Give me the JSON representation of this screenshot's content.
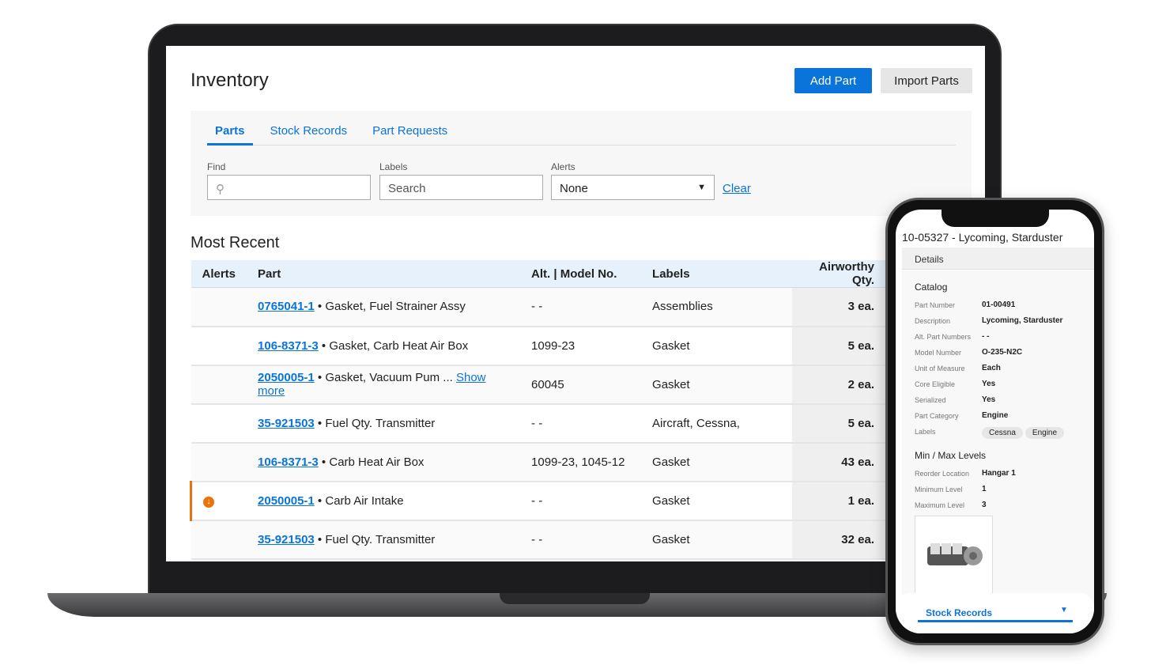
{
  "header": {
    "title": "Inventory",
    "add_part": "Add Part",
    "import_parts": "Import Parts"
  },
  "tabs": [
    {
      "label": "Parts",
      "active": true
    },
    {
      "label": "Stock Records"
    },
    {
      "label": "Part Requests"
    }
  ],
  "filters": {
    "find_label": "Find",
    "find_value": "",
    "labels_label": "Labels",
    "labels_placeholder": "Search",
    "alerts_label": "Alerts",
    "alerts_value": "None",
    "clear": "Clear"
  },
  "section_title": "Most Recent",
  "table": {
    "columns": [
      "Alerts",
      "Part",
      "Alt. | Model No.",
      "Labels",
      "Airworthy Qty."
    ],
    "rows": [
      {
        "alert": false,
        "part_number": "0765041-1",
        "description": "Gasket, Fuel Strainer Assy",
        "show_more": "",
        "model": "- -",
        "labels": "Assemblies",
        "qty": "3 ea."
      },
      {
        "alert": false,
        "part_number": "106-8371-3",
        "description": "Gasket, Carb Heat Air Box",
        "show_more": "",
        "model": "1099-23",
        "labels": "Gasket",
        "qty": "5 ea."
      },
      {
        "alert": false,
        "part_number": "2050005-1",
        "description": "Gasket, Vacuum Pum ...",
        "show_more": "Show more",
        "model": "60045",
        "labels": "Gasket",
        "qty": "2 ea."
      },
      {
        "alert": false,
        "part_number": "35-921503",
        "description": "Fuel Qty. Transmitter",
        "show_more": "",
        "model": "- -",
        "labels": "Aircraft, Cessna,",
        "qty": "5 ea."
      },
      {
        "alert": false,
        "part_number": "106-8371-3",
        "description": "Carb Heat Air Box",
        "show_more": "",
        "model": "1099-23, 1045-12",
        "labels": "Gasket",
        "qty": "43 ea."
      },
      {
        "alert": true,
        "part_number": "2050005-1",
        "description": "Carb Air Intake",
        "show_more": "",
        "model": "- -",
        "labels": "Gasket",
        "qty": "1 ea."
      },
      {
        "alert": false,
        "part_number": "35-921503",
        "description": "Fuel Qty. Transmitter",
        "show_more": "",
        "model": "- -",
        "labels": "Gasket",
        "qty": "32 ea."
      }
    ]
  },
  "phone": {
    "title": "10-05327 - Lycoming, Starduster",
    "details_tab": "Details",
    "catalog_title": "Catalog",
    "catalog": [
      {
        "k": "Part Number",
        "v": "01-00491"
      },
      {
        "k": "Description",
        "v": "Lycoming, Starduster"
      },
      {
        "k": "Alt. Part Numbers",
        "v": "- -"
      },
      {
        "k": "Model Number",
        "v": "O-235-N2C"
      },
      {
        "k": "Unit of Measure",
        "v": "Each"
      },
      {
        "k": "Core Eligible",
        "v": "Yes"
      },
      {
        "k": "Serialized",
        "v": "Yes"
      },
      {
        "k": "Part Category",
        "v": "Engine"
      }
    ],
    "labels_key": "Labels",
    "labels": [
      "Cessna",
      "Engine"
    ],
    "minmax_title": "Min / Max Levels",
    "minmax": [
      {
        "k": "Reorder Location",
        "v": "Hangar 1"
      },
      {
        "k": "Minimum Level",
        "v": "1"
      },
      {
        "k": "Maximum Level",
        "v": "3"
      }
    ],
    "footer_tab": "Stock Records"
  },
  "colors": {
    "accent": "#0a74da",
    "alert": "#e8720c"
  }
}
